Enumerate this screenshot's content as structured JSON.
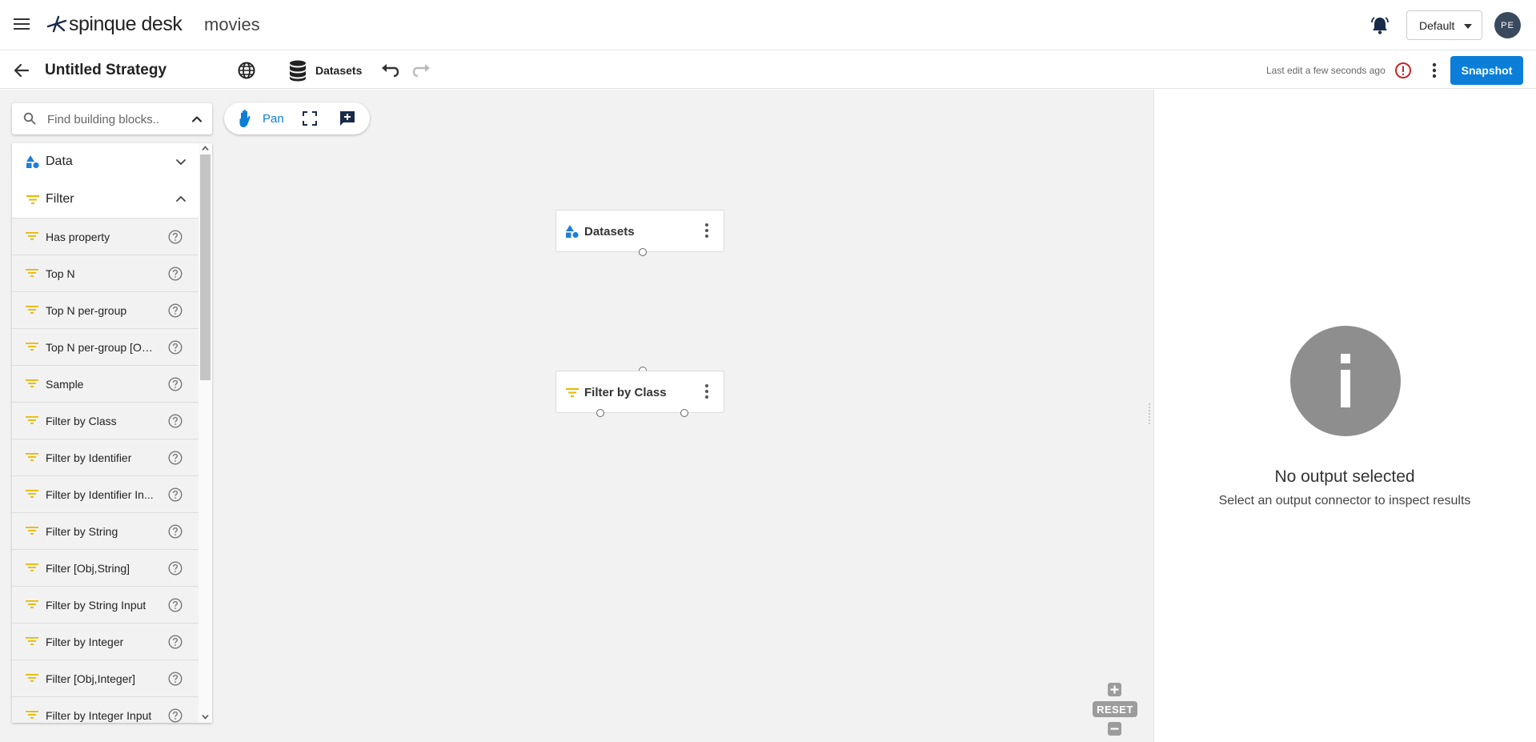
{
  "app": {
    "brand": "spinque desk",
    "project": "movies",
    "environment": "Default",
    "user_initials": "PE"
  },
  "toolbar": {
    "title": "Untitled Strategy",
    "datasets_label": "Datasets",
    "last_edit": "Last edit a few seconds ago",
    "snapshot_label": "Snapshot"
  },
  "sidebar": {
    "search_placeholder": "Find building blocks..",
    "categories": [
      {
        "label": "Data",
        "expanded": false
      },
      {
        "label": "Filter",
        "expanded": true
      }
    ],
    "filter_items": [
      "Has property",
      "Top N",
      "Top N per-group",
      "Top N per-group [Ob...",
      "Sample",
      "Filter by Class",
      "Filter by Identifier",
      "Filter by Identifier In...",
      "Filter by String",
      "Filter [Obj,String]",
      "Filter by String Input",
      "Filter by Integer",
      "Filter [Obj,Integer]",
      "Filter by Integer Input"
    ]
  },
  "canvas": {
    "pan_label": "Pan",
    "nodes": [
      {
        "label": "Datasets",
        "icon": "data-shapes-icon"
      },
      {
        "label": "Filter by Class",
        "icon": "filter-icon"
      }
    ],
    "zoom_reset_label": "RESET"
  },
  "output_panel": {
    "title": "No output selected",
    "subtitle": "Select an output connector to inspect results"
  },
  "colors": {
    "accent": "#0a7ed8",
    "filter_icon": "#e6b800",
    "data_icon": "#1f7fd6",
    "canvas_bg": "#f2f2f2",
    "info_grey": "#8e8e8e"
  }
}
